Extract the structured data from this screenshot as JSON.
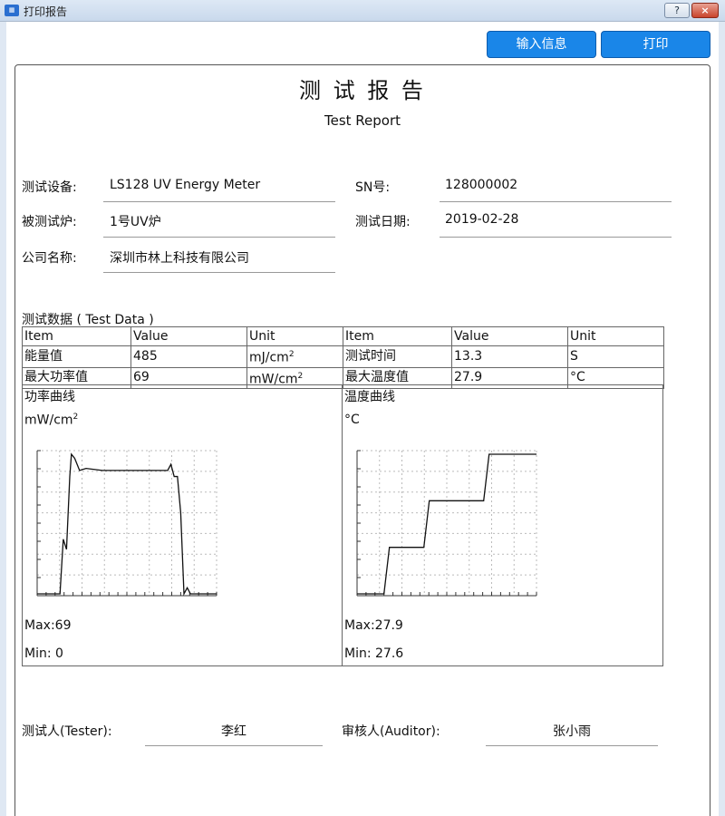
{
  "window": {
    "title": "打印报告",
    "help": "?",
    "close": "×",
    "icon": "report-app-icon"
  },
  "toolbar": {
    "input_info": "输入信息",
    "print": "打印"
  },
  "report": {
    "title_cn": "测 试 报 告",
    "title_en": "Test Report",
    "info": {
      "device_label": "测试设备:",
      "device_value": "LS128 UV Energy Meter",
      "sn_label": "SN号:",
      "sn_value": "128000002",
      "furnace_label": "被测试炉:",
      "furnace_value": "1号UV炉",
      "date_label": "测试日期:",
      "date_value": "2019-02-28",
      "company_label": "公司名称:",
      "company_value": "深圳市林上科技有限公司"
    },
    "data_section_title": "测试数据 ( Test Data )",
    "table": {
      "header": [
        "Item",
        "Value",
        "Unit",
        "Item",
        "Value",
        "Unit"
      ],
      "rows": [
        {
          "item1": "能量值",
          "value1": "485",
          "unit1_base": "mJ/cm",
          "unit1_sup": "2",
          "item2": "测试时间",
          "value2": "13.3",
          "unit2": "S"
        },
        {
          "item1": "最大功率值",
          "value1": "69",
          "unit1_base": "mW/cm",
          "unit1_sup": "2",
          "item2": "最大温度值",
          "value2": "27.9",
          "unit2": "°C"
        }
      ]
    },
    "power_curve": {
      "title": "功率曲线",
      "unit_base": "mW/cm",
      "unit_sup": "2",
      "max": "Max:69",
      "min": "Min: 0"
    },
    "temp_curve": {
      "title": "温度曲线",
      "unit": "°C",
      "max": "Max:27.9",
      "min": "Min: 27.6"
    },
    "signatures": {
      "tester_label": "测试人(Tester):",
      "tester_name": "李红",
      "auditor_label": "审核人(Auditor):",
      "auditor_name": "张小雨"
    }
  },
  "chart_data": [
    {
      "type": "line",
      "xlabel": "",
      "ylabel": "mW/cm2",
      "ylim": [
        0,
        69
      ],
      "x": [
        0,
        0.5,
        1,
        1.4,
        1.6,
        1.8,
        2,
        2.1,
        2.3,
        2.6,
        3,
        4,
        5,
        6,
        7,
        8,
        8.2,
        8.4,
        8.6,
        8.8,
        9,
        9.2,
        9.4,
        10,
        11
      ],
      "y": [
        0,
        0,
        0,
        0,
        27,
        22,
        58,
        69,
        67,
        61,
        62,
        61,
        61,
        61,
        61,
        61,
        64,
        58,
        58,
        40,
        0,
        3,
        0,
        0,
        0
      ]
    },
    {
      "type": "line",
      "xlabel": "",
      "ylabel": "°C",
      "ylim": [
        27.6,
        27.9
      ],
      "x": [
        0,
        1,
        2,
        3,
        4,
        5,
        6,
        7,
        8,
        9
      ],
      "y": [
        27.6,
        27.6,
        27.7,
        27.7,
        27.8,
        27.8,
        27.8,
        27.9,
        27.9,
        27.9
      ]
    }
  ]
}
